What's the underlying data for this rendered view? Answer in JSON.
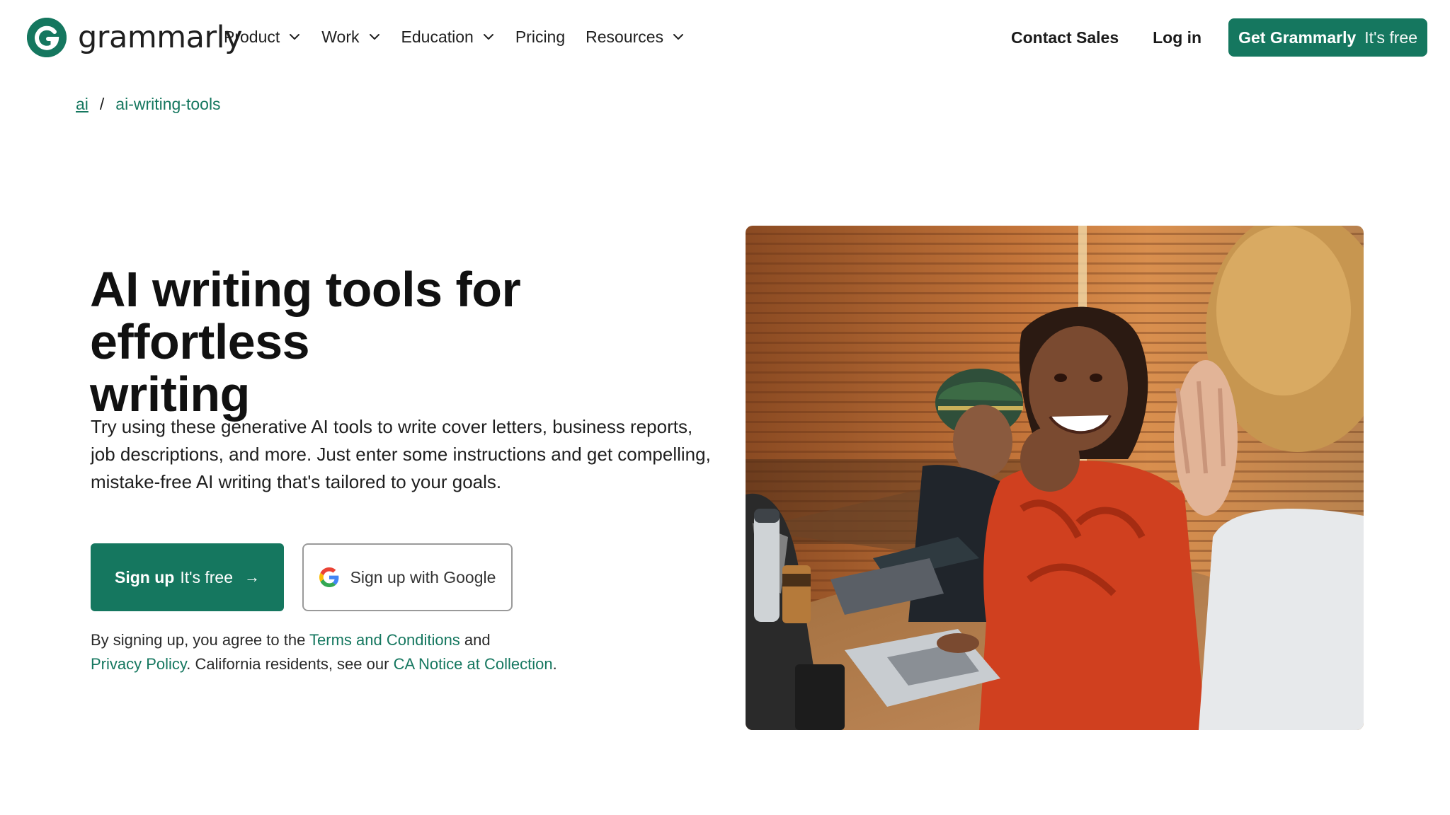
{
  "header": {
    "logo_text": "grammarly",
    "nav": [
      {
        "label": "Product",
        "has_dropdown": true
      },
      {
        "label": "Work",
        "has_dropdown": true
      },
      {
        "label": "Education",
        "has_dropdown": true
      },
      {
        "label": "Pricing",
        "has_dropdown": false
      },
      {
        "label": "Resources",
        "has_dropdown": true
      }
    ],
    "contact_sales": "Contact Sales",
    "log_in": "Log in",
    "get_button": {
      "strong": "Get Grammarly",
      "light": "It's free"
    }
  },
  "breadcrumb": {
    "items": [
      "ai",
      "ai-writing-tools"
    ],
    "separator": "/"
  },
  "hero": {
    "title_line1": "AI writing tools for effortless",
    "title_line2": "writing",
    "desc_line1": "Try using these generative AI tools to write cover letters, business reports,",
    "desc_line2": "job descriptions, and more. Just enter some instructions and get compelling,",
    "desc_line3": "mistake-free AI writing that's tailored to your goals.",
    "signup_button": {
      "strong": "Sign up",
      "light": "It's free",
      "arrow": "→"
    },
    "google_button": "Sign up with Google",
    "legal": {
      "t1": "By signing up, you agree to the ",
      "terms": "Terms and Conditions",
      "t2": " and",
      "privacy": "Privacy Policy",
      "t3": ". California residents, see our ",
      "ca_notice": "CA Notice at Collection",
      "t4": "."
    }
  },
  "colors": {
    "brand_green": "#15775f",
    "text": "#1a1a1a",
    "google_blue": "#4285F4",
    "google_red": "#EA4335",
    "google_yellow": "#FBBC05",
    "google_green": "#34A853"
  },
  "icons": {
    "logo": "grammarly-g-icon",
    "dropdown": "chevron-down-icon",
    "google": "google-g-icon",
    "arrow": "arrow-right-icon"
  }
}
